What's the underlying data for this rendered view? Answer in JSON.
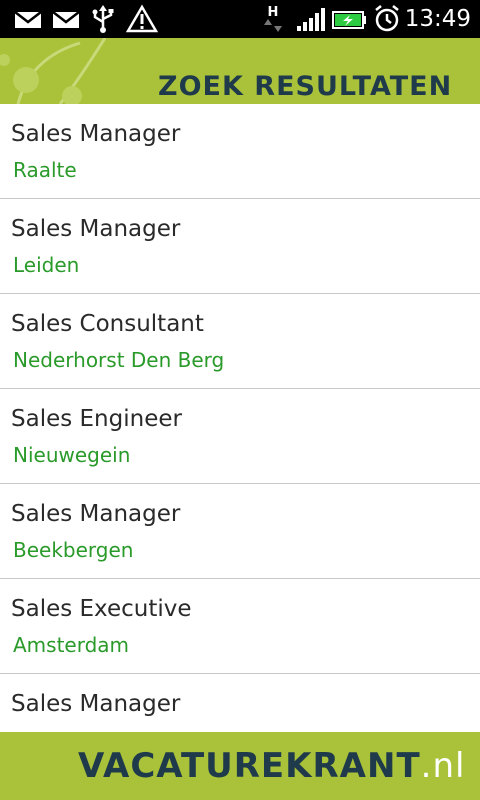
{
  "status_bar": {
    "time": "13:49",
    "icons": [
      "mail-icon",
      "mail-icon",
      "usb-icon",
      "warning-icon",
      "network-h-icon",
      "signal-icon",
      "battery-charging-icon",
      "alarm-icon"
    ],
    "network_type": "H",
    "accent_color": "#2ecc40"
  },
  "header": {
    "title": "ZOEK RESULTATEN",
    "background_color": "#a9c23a",
    "title_color": "#1f3a4a"
  },
  "results": [
    {
      "title": "Sales Manager",
      "location": "Raalte"
    },
    {
      "title": "Sales Manager",
      "location": "Leiden"
    },
    {
      "title": "Sales Consultant",
      "location": "Nederhorst Den Berg"
    },
    {
      "title": "Sales Engineer",
      "location": "Nieuwegein"
    },
    {
      "title": "Sales Manager",
      "location": "Beekbergen"
    },
    {
      "title": "Sales Executive",
      "location": "Amsterdam"
    },
    {
      "title": "Sales Manager",
      "location": ""
    }
  ],
  "colors": {
    "location_text": "#2a9a2a",
    "title_text": "#2a2a2a",
    "divider": "#c8c8c8"
  },
  "footer": {
    "logo_main": "VACATUREKRANT",
    "logo_tld": ".nl",
    "background_color": "#a9c23a"
  }
}
